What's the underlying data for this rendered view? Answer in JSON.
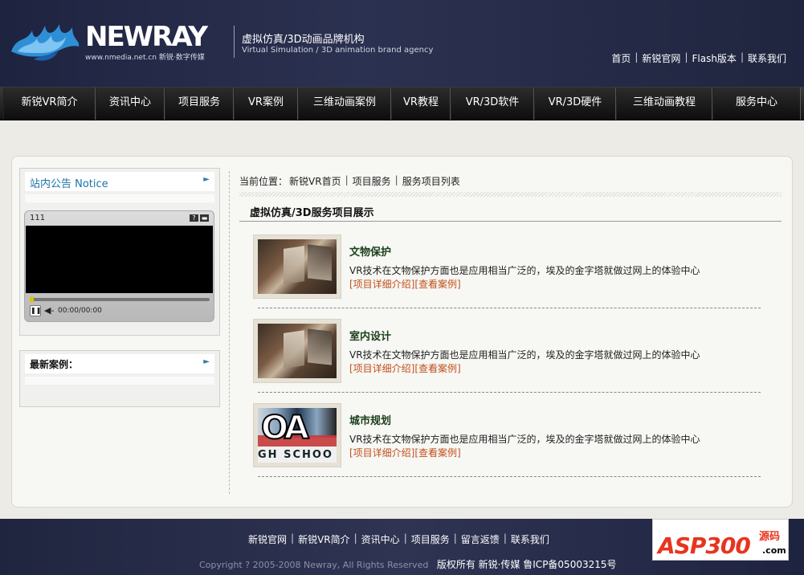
{
  "header": {
    "logo_text": "NEWRAY",
    "logo_sub": "www.nmedia.net.cn 新锐·数字传媒",
    "tagline_cn": "虚拟仿真/3D动画品牌机构",
    "tagline_en": "Virtual Simulation / 3D animation brand agency",
    "top_links": [
      "首页",
      "新锐官网",
      "Flash版本",
      "联系我们"
    ]
  },
  "nav": {
    "items": [
      "新锐VR简介",
      "资讯中心",
      "项目服务",
      "VR案例",
      "三维动画案例",
      "VR教程",
      "VR/3D软件",
      "VR/3D硬件",
      "三维动画教程",
      "服务中心"
    ]
  },
  "sidebar": {
    "notice_title": "站内公告 Notice",
    "arrow": "►",
    "player": {
      "title": "111",
      "time": "00:00/00:00",
      "progress": 0
    },
    "cases_title": "最新案例："
  },
  "main": {
    "breadcrumb": [
      "当前位置：",
      "新锐VR首页",
      "项目服务",
      "服务项目列表"
    ],
    "section_title": "虚拟仿真/3D服务项目展示",
    "items": [
      {
        "name": "文物保护",
        "desc": "VR技术在文物保护方面也是应用相当广泛的，埃及的金字塔就做过网上的体验中心",
        "link_detail": "[项目详细介绍]",
        "link_case": "[查看案例]",
        "thumb": "book"
      },
      {
        "name": "室内设计",
        "desc": "VR技术在文物保护方面也是应用相当广泛的，埃及的金字塔就做过网上的体验中心",
        "link_detail": "[项目详细介绍]",
        "link_case": "[查看案例]",
        "thumb": "book"
      },
      {
        "name": "城市规划",
        "desc": "VR技术在文物保护方面也是应用相当广泛的，埃及的金字塔就做过网上的体验中心",
        "link_detail": "[项目详细介绍]",
        "link_case": "[查看案例]",
        "thumb": "graffiti"
      }
    ]
  },
  "footer": {
    "links": [
      "新锐官网",
      "新锐VR简介",
      "资讯中心",
      "项目服务",
      "留言返馈",
      "联系我们"
    ],
    "copyright": "Copyright ? 2005-2008 Newray, All Rights Reserved",
    "rights": "版权所有 新锐·传媒 鲁ICP备05003215号"
  },
  "watermark": {
    "brand": "ASP300",
    "tag": "源码",
    "domain": ".com"
  }
}
